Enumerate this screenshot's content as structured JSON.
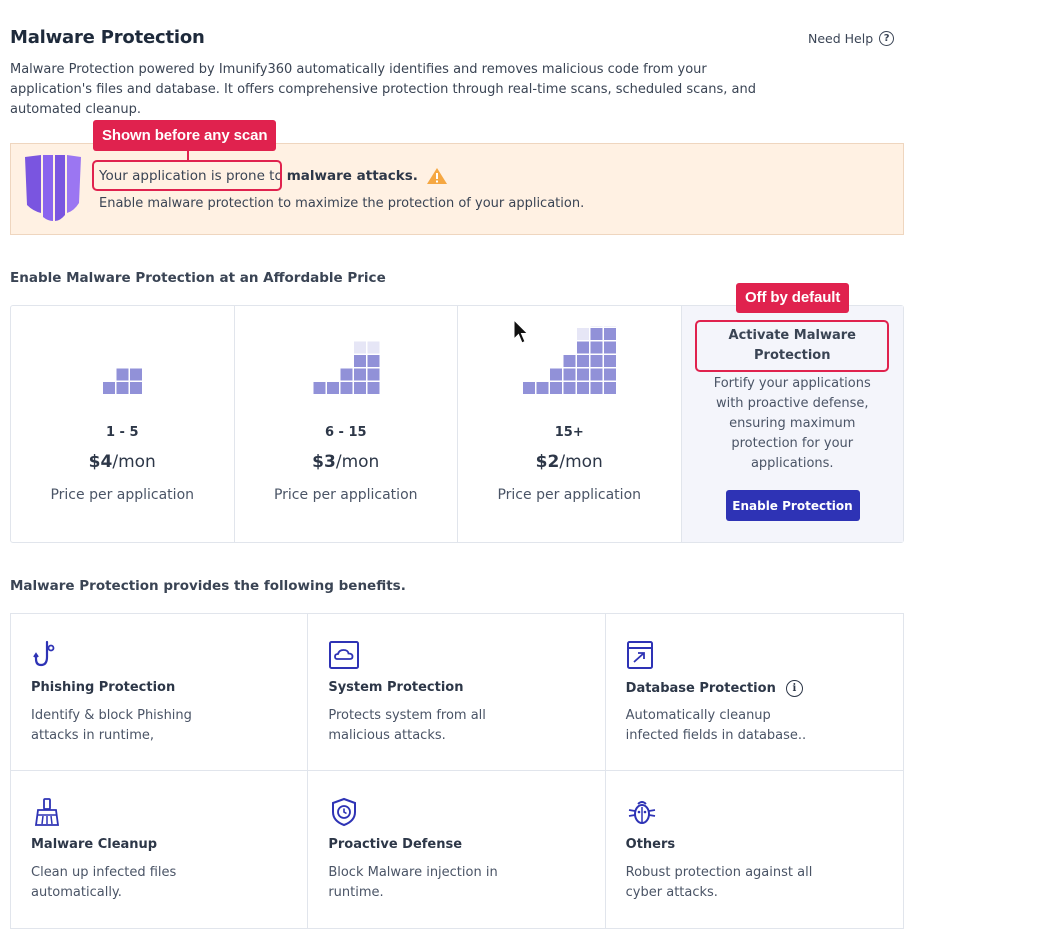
{
  "header": {
    "title": "Malware Protection",
    "help_label": "Need Help",
    "help_icon": "question-circle-icon",
    "intro": "Malware Protection powered by Imunify360 automatically identifies and removes malicious code from your application's files and database. It offers comprehensive protection through real-time scans, scheduled scans, and automated cleanup."
  },
  "alert": {
    "icon": "shield-icon",
    "line1_prefix": "Your application is prone to",
    "line1_bold": "malware attacks.",
    "warning_icon": "warning-triangle-icon",
    "line2": "Enable malware protection to maximize the protection of your application."
  },
  "annotations": {
    "scan_callout": "Shown before any scan",
    "default_callout": "Off by default",
    "color": "#e0224e"
  },
  "pricing": {
    "section_title": "Enable Malware Protection at an Affordable Price",
    "tiers": [
      {
        "range": "1 - 5",
        "price": "$4",
        "unit": "/mon",
        "note": "Price per application"
      },
      {
        "range": "6 - 15",
        "price": "$3",
        "unit": "/mon",
        "note": "Price per application"
      },
      {
        "range": "15+",
        "price": "$2",
        "unit": "/mon",
        "note": "Price per application"
      }
    ],
    "activate": {
      "title": "Activate Malware Protection",
      "description": "Fortify your applications with proactive defense, ensuring maximum protection for your applications.",
      "button": "Enable Protection"
    },
    "colors": {
      "bar_dark": "#9191d8",
      "bar_light": "#e6e6f6",
      "button": "#2e33b5"
    }
  },
  "benefits": {
    "section_title": "Malware Protection provides the following benefits.",
    "items": [
      {
        "icon": "hook-icon",
        "title": "Phishing Protection",
        "desc": "Identify & block Phishing attacks in runtime,"
      },
      {
        "icon": "cloud-window-icon",
        "title": "System Protection",
        "desc": "Protects system from all malicious attacks."
      },
      {
        "icon": "database-window-icon",
        "title": "Database Protection",
        "desc": "Automatically cleanup infected fields in database..",
        "info_icon": "info-circle-icon"
      },
      {
        "icon": "broom-icon",
        "title": "Malware Cleanup",
        "desc": "Clean up infected files automatically."
      },
      {
        "icon": "shield-clock-icon",
        "title": "Proactive Defense",
        "desc": "Block Malware injection in runtime."
      },
      {
        "icon": "bug-icon",
        "title": "Others",
        "desc": "Robust protection against all cyber attacks."
      }
    ]
  }
}
